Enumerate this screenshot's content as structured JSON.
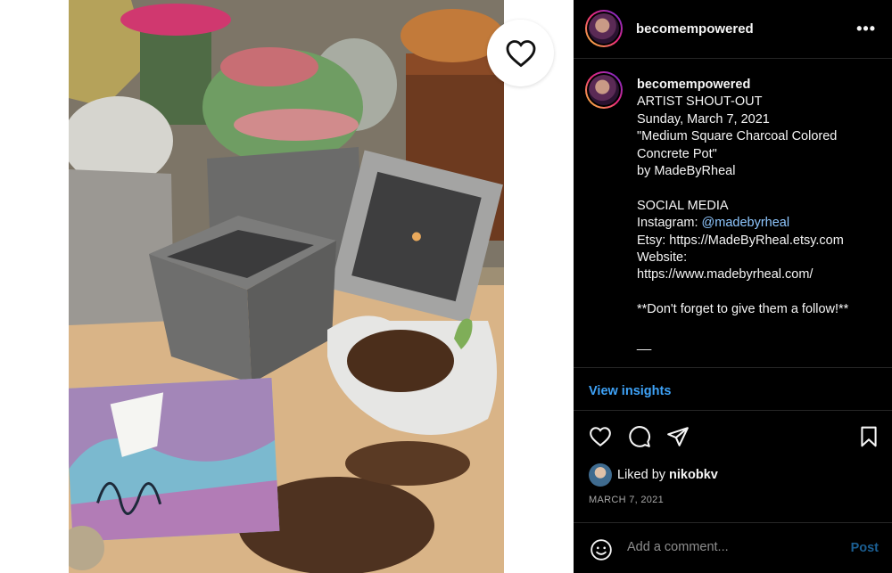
{
  "post": {
    "username": "becomempowered",
    "more_label": "•••",
    "caption_user": "becomempowered",
    "caption_lines": [
      "ARTIST SHOUT-OUT",
      "Sunday, March 7, 2021",
      "\"Medium Square Charcoal Colored",
      "Concrete Pot\"",
      "by MadeByRheal",
      "",
      "SOCIAL MEDIA"
    ],
    "instagram_prefix": "Instagram: ",
    "instagram_handle": "@madebyrheal",
    "caption_lines_2": [
      "Etsy: https://MadeByRheal.etsy.com",
      "Website:",
      "https://www.madebyrheal.com/",
      "",
      "**Don't forget to give them a follow!**",
      "",
      "__"
    ],
    "view_insights": "View insights",
    "liked_by_prefix": "Liked by ",
    "liked_by_user": "nikobkv",
    "date": "MARCH 7, 2021",
    "comment_placeholder": "Add a comment...",
    "post_label": "Post"
  },
  "icons": {
    "like": "heart-icon",
    "comment": "comment-icon",
    "share": "paper-plane-icon",
    "save": "bookmark-icon",
    "emoji": "smiley-icon"
  },
  "colors": {
    "panel_bg": "#000000",
    "link_blue": "#3ea2f7",
    "mention_blue": "#8fc7ff",
    "post_disabled": "#1b5f93"
  }
}
